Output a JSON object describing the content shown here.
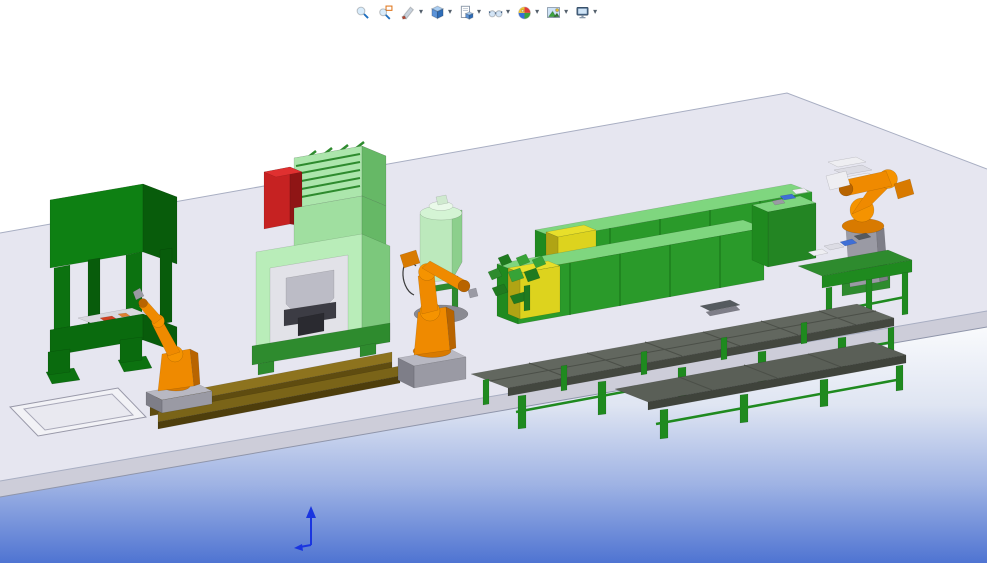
{
  "toolbar": {
    "dropdown_glyph": "▾",
    "items": [
      {
        "name": "zoom-to-fit",
        "has_dropdown": false
      },
      {
        "name": "zoom-to-area",
        "has_dropdown": false
      },
      {
        "name": "section-view",
        "has_dropdown": true
      },
      {
        "name": "view-orientation",
        "has_dropdown": true
      },
      {
        "name": "display-style",
        "has_dropdown": true
      },
      {
        "name": "hide-show-items",
        "has_dropdown": true
      },
      {
        "name": "edit-appearance",
        "has_dropdown": true
      },
      {
        "name": "apply-scene",
        "has_dropdown": true
      },
      {
        "name": "view-settings",
        "has_dropdown": true
      }
    ]
  },
  "viewport": {
    "background_top": "#ffffff",
    "background_bottom": "#4f74d2",
    "floor_top_color": "#e6e6f0",
    "floor_front_color": "#cdcdd9"
  },
  "scene": {
    "objects": [
      {
        "name": "hydraulic-press",
        "color": "#0e8013"
      },
      {
        "name": "press-robot",
        "color": "#ef8a00"
      },
      {
        "name": "transfer-rail",
        "color": "#8d731e"
      },
      {
        "name": "molding-machine",
        "color": "#b9edb9"
      },
      {
        "name": "hopper-dryer",
        "color": "#bce9bc"
      },
      {
        "name": "handling-robot",
        "color": "#ef8a00"
      },
      {
        "name": "extrusion-line-rear",
        "color": "#2a9a2a"
      },
      {
        "name": "extrusion-line-front",
        "color": "#2a9a2a"
      },
      {
        "name": "yellow-cabinet-rear",
        "color": "#ddd31e"
      },
      {
        "name": "yellow-cabinet-front",
        "color": "#ddd31e"
      },
      {
        "name": "control-cabinet",
        "color": "#238523"
      },
      {
        "name": "unload-robot",
        "color": "#ef8a00"
      },
      {
        "name": "unload-table",
        "color": "#2e8b2e"
      },
      {
        "name": "conveyor-table-long",
        "color": "#62675f"
      },
      {
        "name": "conveyor-table-front",
        "color": "#5a5f57"
      },
      {
        "name": "fixture-parts",
        "color": "#2e8b2e"
      },
      {
        "name": "floor-pit",
        "color": "#f2f2f6"
      },
      {
        "name": "origin-marker",
        "color": "#1a35e0"
      }
    ]
  }
}
